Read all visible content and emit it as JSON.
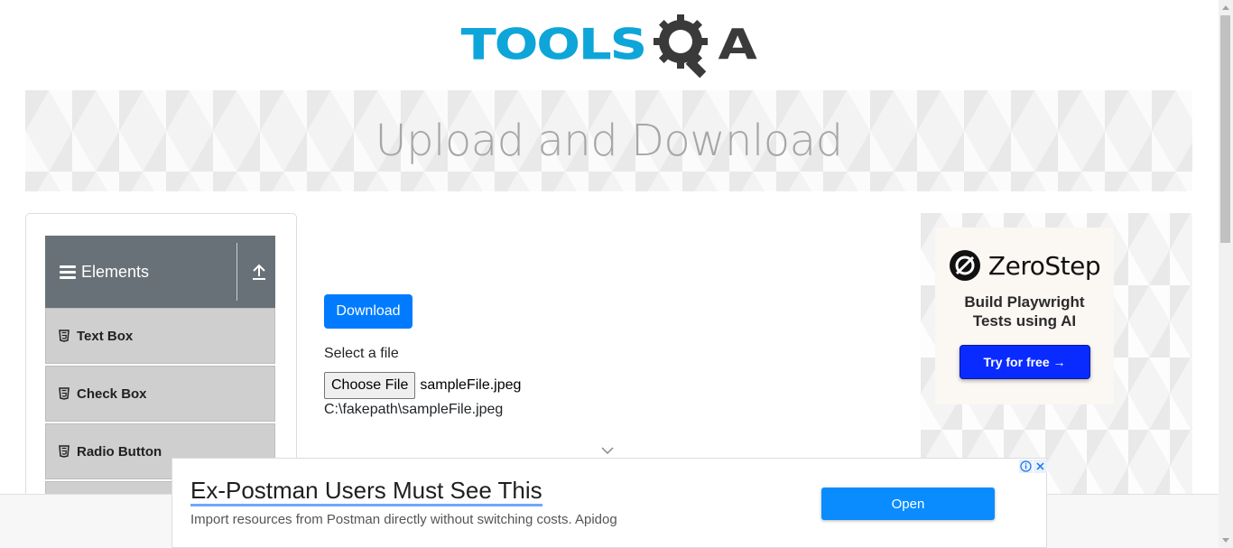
{
  "header": {
    "logo_text": "TOOLS",
    "logo_letter": "A",
    "logo_alt": "ToolsQA"
  },
  "banner": {
    "title": "Upload and Download"
  },
  "sidebar": {
    "group_title": "Elements",
    "items": [
      {
        "label": "Text Box",
        "icon": "html5-icon"
      },
      {
        "label": "Check Box",
        "icon": "html5-icon"
      },
      {
        "label": "Radio Button",
        "icon": "html5-icon"
      }
    ]
  },
  "main": {
    "download_label": "Download",
    "select_label": "Select a file",
    "choose_file_label": "Choose File",
    "chosen_file_name": "sampleFile.jpeg",
    "uploaded_path": "C:\\fakepath\\sampleFile.jpeg"
  },
  "right_ad": {
    "brand": "ZeroStep",
    "tagline": "Build Playwright Tests using AI",
    "cta_label": "Try for free →",
    "cta_color": "#0a2bff"
  },
  "bottom_ad": {
    "headline": "Ex-Postman Users Must See This",
    "description": "Import resources from Postman directly without switching costs. Apidog",
    "open_label": "Open",
    "open_color": "#0a8cff"
  },
  "colors": {
    "logo_blue": "#0ea5d9",
    "logo_dark": "#3a3a3a",
    "sidebar_header": "#687178",
    "primary": "#007bff"
  }
}
